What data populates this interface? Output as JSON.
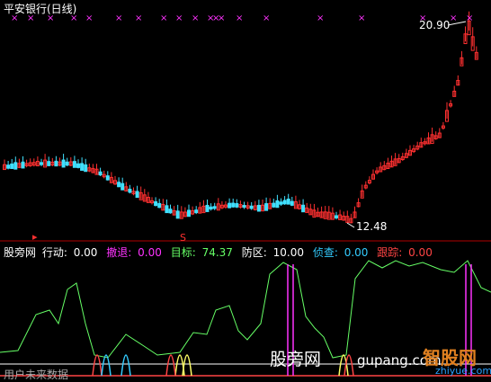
{
  "title": "平安银行(日线)",
  "labels": {
    "high": "20.90",
    "low": "12.48",
    "marker": "S"
  },
  "indicator": {
    "name": "股旁网",
    "items": [
      {
        "label": "行动:",
        "value": "0.00",
        "color": "#ffffff"
      },
      {
        "label": "撤退:",
        "value": "0.00",
        "color": "#ff33ff"
      },
      {
        "label": "目标:",
        "value": "74.37",
        "color": "#66ff66"
      },
      {
        "label": "防区:",
        "value": "10.00",
        "color": "#ffffff"
      },
      {
        "label": "侦查:",
        "value": "0.00",
        "color": "#33ccff"
      },
      {
        "label": "跟踪:",
        "value": "0.00",
        "color": "#ff4444"
      }
    ]
  },
  "watermark": "股旁网",
  "watermark_url": "gupang.com",
  "footer": "用户未来数据",
  "logo": {
    "text": "智股网",
    "url": "zhiyue.com"
  },
  "colors": {
    "up": "#ff3030",
    "down": "#40e0ff",
    "target": "#66ff66",
    "retreat": "#ff33ff",
    "zone": "#ffffff",
    "track": "#ff4444"
  }
}
